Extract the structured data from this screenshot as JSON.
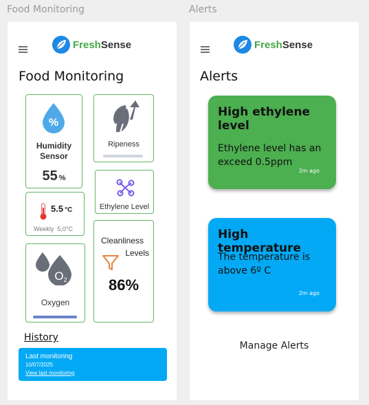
{
  "frames": {
    "monitoring_title": "Food Monitoring",
    "alerts_title": "Alerts"
  },
  "brand": {
    "fresh": "Fresh",
    "sense": "Sense",
    "logo_icon": "leaf-icon",
    "accent": "#46a948",
    "blue": "#1e88e5"
  },
  "monitoring": {
    "title": "Food Monitoring",
    "humidity": {
      "label": "Humidity Sensor",
      "value": "55",
      "unit": "%",
      "icon": "humidity-drop-icon"
    },
    "ripeness": {
      "label": "Ripeness",
      "icon": "ripeness-icon"
    },
    "ethylene": {
      "label": "Ethylene Level",
      "icon": "molecule-icon"
    },
    "temperature": {
      "value": "5.5",
      "unit": "°C",
      "weekly_label": "Weekly",
      "weekly_value": "5,0°C",
      "icon": "thermometer-icon"
    },
    "oxygen": {
      "label": "Oxygen",
      "icon": "oxygen-icon"
    },
    "cleanliness": {
      "label_line1": "Cleanliness",
      "label_line2": "Levels",
      "value": "86%",
      "icon": "filter-icon"
    },
    "history_label": "History",
    "last_monitoring": {
      "title": "Last monitoring",
      "date": "10/07/2025",
      "link": "View last monitoring"
    }
  },
  "alerts": {
    "title": "Alerts",
    "items": [
      {
        "title": "High ethylene level",
        "message": "Ethylene level has an exceed 0.5ppm",
        "time": "2m ago",
        "color": "#4caf50"
      },
      {
        "title": "High temperature",
        "message": "The temperature is above 6º C",
        "time": "2m ago",
        "color": "#03a9f4"
      }
    ],
    "manage_label": "Manage Alerts"
  }
}
